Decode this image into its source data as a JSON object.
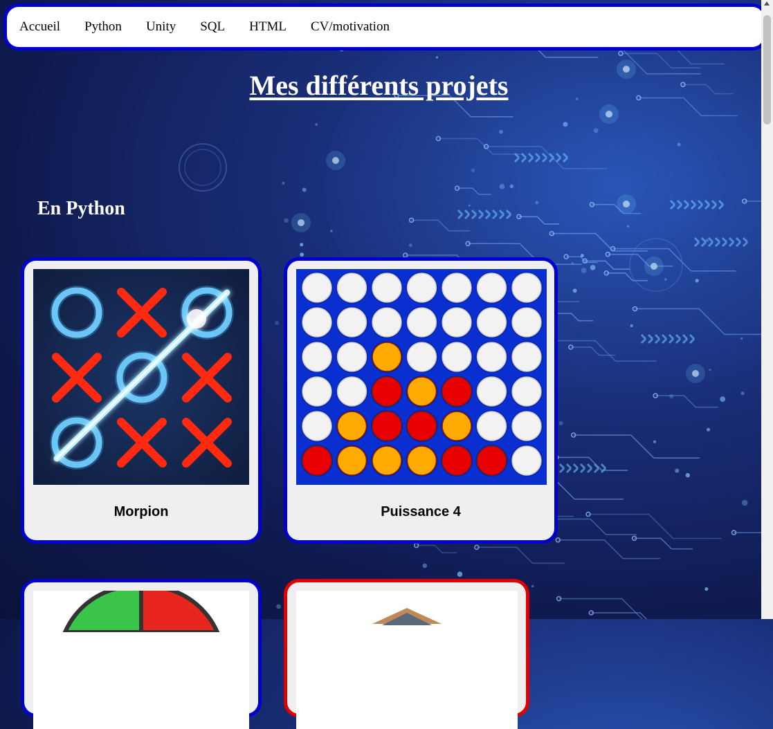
{
  "nav": {
    "items": [
      "Accueil",
      "Python",
      "Unity",
      "SQL",
      "HTML",
      "CV/motivation"
    ]
  },
  "page": {
    "title": "Mes différents projets",
    "section_python": "En Python"
  },
  "projects": [
    {
      "label": "Morpion",
      "image": "tic-tac-toe-image"
    },
    {
      "label": "Puissance 4",
      "image": "connect-four-image"
    }
  ],
  "colors": {
    "accent_blue": "#0000d0",
    "accent_red": "#e00000",
    "card_bg": "#efefef",
    "page_bg": "#0f1a4f"
  }
}
